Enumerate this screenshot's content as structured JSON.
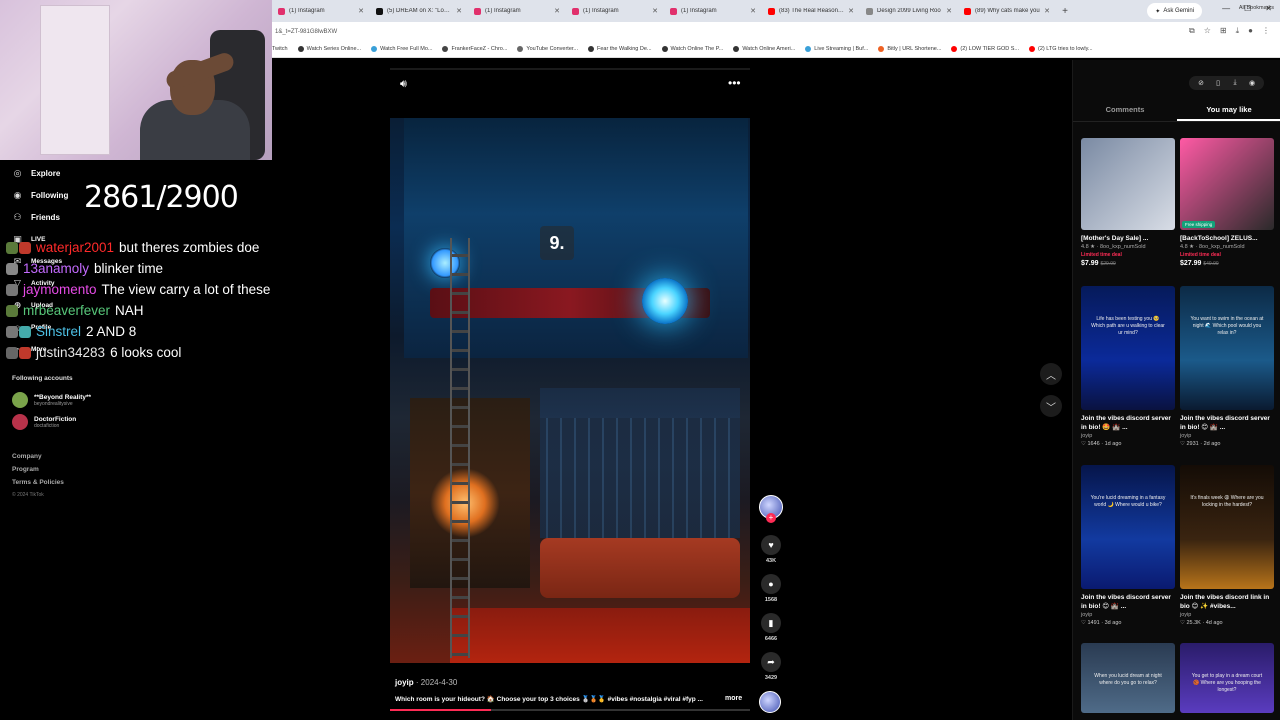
{
  "browser": {
    "tabs": [
      {
        "label": "(1) Instagram",
        "color": "#e1306c"
      },
      {
        "label": "(5) DREAM on X: \"Lookin",
        "color": "#111111"
      },
      {
        "label": "(1) Instagram",
        "color": "#e1306c"
      },
      {
        "label": "(1) Instagram",
        "color": "#e1306c"
      },
      {
        "label": "(1) Instagram",
        "color": "#e1306c"
      },
      {
        "label": "(83) The Real Reason G",
        "color": "#ff0000"
      },
      {
        "label": "Design 2099 Living Roo",
        "color": "#888888"
      },
      {
        "label": "(89) Why cats make you",
        "color": "#ff0000"
      }
    ],
    "new_tab": "+",
    "ask_gemini": "Ask Gemini",
    "url": "1&_t=ZT-981G8lwBXW",
    "bookmarks": [
      {
        "label": "Twitch",
        "color": "#9146ff"
      },
      {
        "label": "Watch Series Online...",
        "color": "#333333"
      },
      {
        "label": "Watch Free Full Mo...",
        "color": "#3aa0d8"
      },
      {
        "label": "FrankerFaceZ - Chro...",
        "color": "#444444"
      },
      {
        "label": "YouTube Converter...",
        "color": "#666666"
      },
      {
        "label": "Fear the Walking De...",
        "color": "#333333"
      },
      {
        "label": "Watch Online The P...",
        "color": "#333333"
      },
      {
        "label": "Watch Online Ameri...",
        "color": "#333333"
      },
      {
        "label": "Live Streaming | Buf...",
        "color": "#3aa0d8"
      },
      {
        "label": "Bitly | URL Shortene...",
        "color": "#ee6123"
      },
      {
        "label": "(2) LOW TIER GOD S...",
        "color": "#ff0000"
      },
      {
        "label": "(2) LTG tries to lowly...",
        "color": "#ff0000"
      }
    ],
    "all_bookmarks": "All Bookmarks"
  },
  "nav": {
    "items": [
      {
        "label": "Explore",
        "icon": "compass-icon"
      },
      {
        "label": "Following",
        "icon": "following-icon"
      },
      {
        "label": "Friends",
        "icon": "friends-icon"
      },
      {
        "label": "LIVE",
        "icon": "live-icon"
      },
      {
        "label": "Messages",
        "icon": "messages-icon"
      },
      {
        "label": "Activity",
        "icon": "activity-icon"
      },
      {
        "label": "Upload",
        "icon": "upload-icon"
      },
      {
        "label": "Profile",
        "icon": "profile-icon"
      },
      {
        "label": "More",
        "icon": "more-icon"
      }
    ],
    "following_accounts_header": "Following accounts",
    "accounts": [
      {
        "name": "**Beyond Reality**",
        "handle": "beyondrealitysive"
      },
      {
        "name": "DoctorFiction",
        "handle": "doctafiction"
      }
    ],
    "footer": [
      "Company",
      "Program",
      "Terms & Policies"
    ],
    "copyright": "© 2024 TikTok"
  },
  "stream": {
    "counter": "2861/2900",
    "chat": [
      {
        "user": "waterjar2001",
        "color": "#ff2a2a",
        "msg": "but theres zombies doe"
      },
      {
        "user": "13anamoly",
        "color": "#c46bff",
        "msg": "blinker time"
      },
      {
        "user": "jaymomento",
        "color": "#e64be6",
        "msg": "The view carry a lot of these"
      },
      {
        "user": "mrbeaverfever",
        "color": "#58c77a",
        "msg": "NAH"
      },
      {
        "user": "Sinstrel",
        "color": "#4ec1e6",
        "msg": "2 AND 8"
      },
      {
        "user": "justin34283",
        "color": "#e6e6e6",
        "msg": "6 looks cool"
      }
    ]
  },
  "video": {
    "number_tag": "9.",
    "author": "joyip",
    "date": "2024-4-30",
    "caption": "Which room is your hideout? 🏠 Choose your top 3 choices 🥈🥉🥇 #vibes #nostalgia #viral #fyp ...",
    "more": "more",
    "progress": 0.28,
    "likes": "43K",
    "comments": "1568",
    "saves": "6466",
    "shares": "3429"
  },
  "right_panel": {
    "tabs": [
      "Comments",
      "You may like"
    ],
    "active_tab": "You may like",
    "cards": [
      {
        "kind": "product",
        "title": "[Mother's Day Sale] ...",
        "sub": "4.8 ★ · 8oo_kxp_numSold",
        "deal": "Limited time deal",
        "price": "$7.99",
        "old_price": "$29.99"
      },
      {
        "kind": "product",
        "title": "[BackToSchool] ZELUS...",
        "sub": "4.8 ★ · 8oo_kxp_numSold",
        "deal": "Limited time deal",
        "price": "$27.99",
        "old_price": "$49.99",
        "badge": "Free shipping"
      },
      {
        "kind": "video",
        "title": "Join the vibes discord server in bio! 🤩 🏰 ...",
        "author": "joyip",
        "likes": "1646",
        "age": "1d ago",
        "thumb_text": "Life has been testing you 🥺 Which path are u walking to clear ur mind?"
      },
      {
        "kind": "video",
        "title": "Join the vibes discord server in bio! 😊 🏰 ...",
        "author": "joyip",
        "likes": "2931",
        "age": "2d ago",
        "thumb_text": "You want to swim in the ocean at night 🌊 Which pool would you relax in?"
      },
      {
        "kind": "video",
        "title": "Join the vibes discord server in bio! 😊 🏰 ...",
        "author": "joyip",
        "likes": "1491",
        "age": "3d ago",
        "thumb_text": "You're lucid dreaming in a fantasy world 🌙 Where would u bike?"
      },
      {
        "kind": "video",
        "title": "Join the vibes discord link in bio 😊 ✨ #vibes...",
        "author": "joyip",
        "likes": "25.3K",
        "age": "4d ago",
        "thumb_text": "It's finals week 😩 Where are you locking in the hardest?"
      },
      {
        "kind": "video",
        "title": "",
        "author": "",
        "likes": "",
        "age": "",
        "thumb_text": "When you lucid dream at night where do you go to relax?"
      },
      {
        "kind": "video",
        "title": "",
        "author": "",
        "likes": "",
        "age": "",
        "thumb_text": "You get to play in a dream court 🏀 Where are you hooping the longest?"
      }
    ]
  }
}
